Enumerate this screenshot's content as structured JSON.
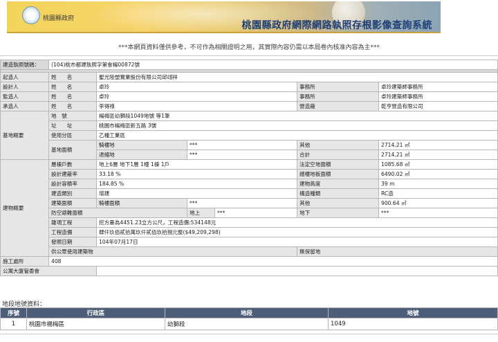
{
  "header": {
    "logo_text": "桃園縣政府",
    "system_title": "桃園縣政府網際網路執照存根影像查詢系統"
  },
  "notice": "***本網頁資料僅供參考，不可作為相關證明之用，其實際內容仍需以本局卷內核准內容為主***",
  "permit": {
    "label": "建造執照號碼：",
    "value": "(104)桃市都建執照字第會楊00872號"
  },
  "people": {
    "owner": {
      "label": "起造人",
      "name_label": "姓　　名",
      "name": "聖光陸塑實業股份有限公司邱翊祥"
    },
    "designer": {
      "label": "設計人",
      "name_label": "姓　　名",
      "name": "卓玲",
      "office_label": "事務所",
      "office": "卓玲建築師事務所"
    },
    "supervisor": {
      "label": "監造人",
      "name_label": "姓　　名",
      "name": "卓玲",
      "office_label": "事務所",
      "office": "卓玲建築師事務所"
    },
    "contractor": {
      "label": "承造人",
      "name_label": "姓　　名",
      "name": "李得祿",
      "firm_label": "營造廠",
      "firm": "乾亨營造有限公司"
    }
  },
  "site": {
    "label": "基地概要",
    "lot_label": "地　號",
    "lot": "楊梅區幼獅段1049地號 等1筆",
    "address_label": "址　　址",
    "address": "桃園市楊梅區新五路 3號",
    "zoning_label": "使用分區",
    "zoning": "乙種工業區",
    "area_label": "基地面積",
    "arcade_label": "騎樓地",
    "arcade_value": "***",
    "other_label": "其他",
    "other_value": "2714.21 ㎡",
    "setback_label": "退縮地",
    "setback_value": "***",
    "total_label": "合計",
    "total_value": "2714.21 ㎡"
  },
  "building": {
    "label": "建物概要",
    "floors_label": "層棟戶數",
    "floors": "地上6層 地下1層 1幢 1棟 1戶",
    "legal_area_label": "法定空地面積",
    "legal_area": "1085.68 ㎡",
    "coverage_label": "設計建蔽率",
    "coverage": "33.18 %",
    "total_floor_label": "總樓地板面積",
    "total_floor": "6490.02 ㎡",
    "far_label": "設計容積率",
    "far": "184.85 %",
    "height_label": "建物高度",
    "height": "39 m",
    "category_label": "建造類別",
    "category": "增建",
    "structure_label": "構造種類",
    "structure": "RC造",
    "build_area_label": "建築面積",
    "arcade_area_label": "騎樓面積",
    "arcade_area": "***",
    "other_label": "其他",
    "other": "900.64 ㎡",
    "shelter_label": "防空避難面積",
    "above_label": "地上",
    "above": "***",
    "below_label": "地下",
    "below": "***",
    "misc_label": "雜項工程",
    "misc": "挖方量為4451.23立方公尺，工程造價:534148元",
    "cost_label": "工程造價",
    "cost": "肆仟玖佰貳拾萬玖仟貳佰玖拾捌元整($49,209,298)",
    "issue_label": "發照日期",
    "issue": "104年07月17日",
    "public_label": "供公眾使用建築物",
    "open_space_label": "無保留地"
  },
  "construction_place": {
    "label": "施工處所",
    "value": "408"
  },
  "apartment": {
    "label": "公寓大廈管委會"
  },
  "lots_section": {
    "title": "地段地號資料：",
    "headers": [
      "序號",
      "行政區",
      "地段",
      "地號"
    ],
    "rows": [
      {
        "seq": "1",
        "district": "桃園市楊梅區",
        "section": "幼獅段",
        "lot": "1049"
      }
    ]
  }
}
